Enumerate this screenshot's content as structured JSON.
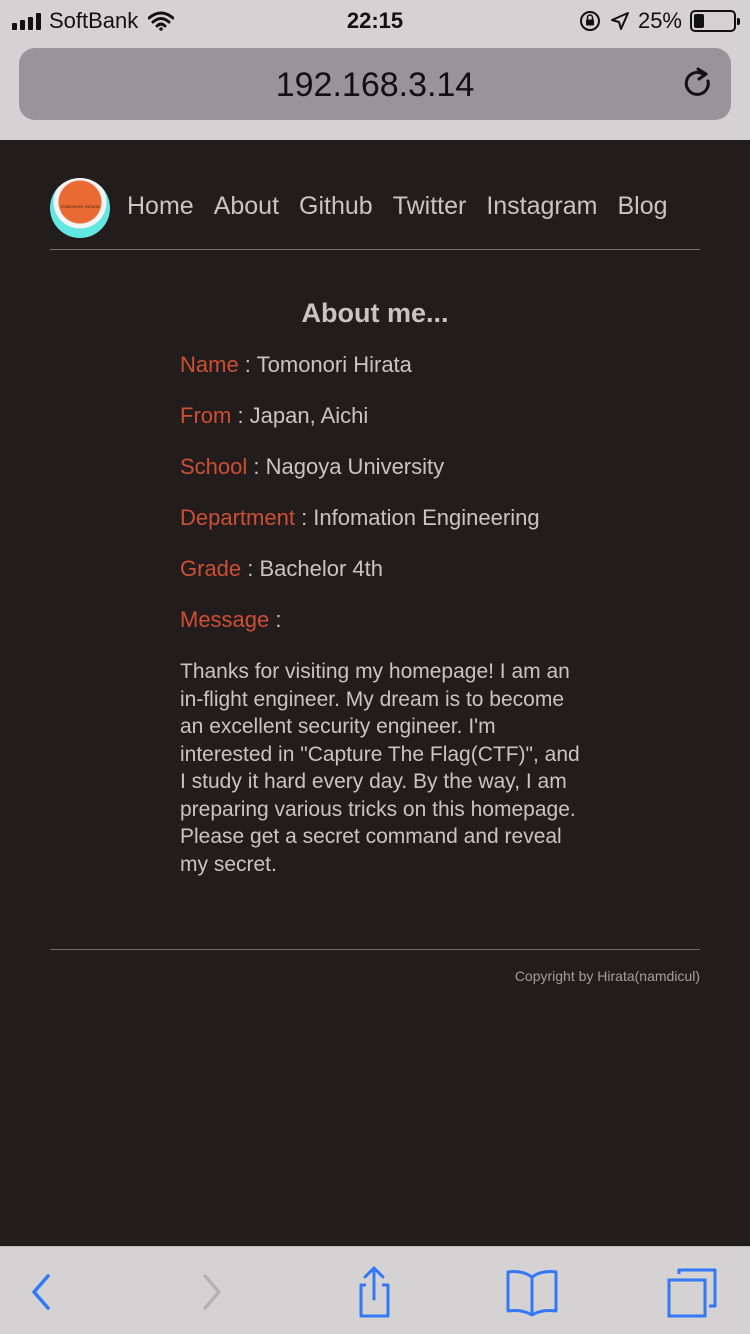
{
  "status_bar": {
    "carrier": "SoftBank",
    "time": "22:15",
    "battery": "25%",
    "battery_level": 0.25,
    "icons": [
      "signal-icon",
      "wifi-icon",
      "rotation-lock-icon",
      "location-icon",
      "battery-icon"
    ]
  },
  "browser": {
    "url": "192.168.3.14",
    "reload_icon": "reload-icon"
  },
  "site": {
    "logo_text": "TOMONORI HIRATA",
    "nav": [
      "Home",
      "About",
      "Github",
      "Twitter",
      "Instagram",
      "Blog"
    ]
  },
  "about": {
    "title": "About me...",
    "fields": [
      {
        "label": "Name",
        "value": " : Tomonori Hirata"
      },
      {
        "label": "From",
        "value": " : Japan, Aichi"
      },
      {
        "label": "School",
        "value": " : Nagoya University"
      },
      {
        "label": "Department",
        "value": " : Infomation Engineering"
      },
      {
        "label": "Grade",
        "value": " : Bachelor 4th"
      },
      {
        "label": "Message",
        "value": " :"
      }
    ],
    "message": "Thanks for visiting my homepage! I am an in-flight engineer. My dream is to become an excellent security engineer. I'm interested in \"Capture The Flag(CTF)\", and I study it hard every day. By the way, I am preparing various tricks on this homepage. Please get a secret command and reveal my secret."
  },
  "footer": {
    "copyright": "Copyright by Hirata(namdicul)"
  },
  "colors": {
    "background": "#231c1c",
    "text": "#c9c3c3",
    "label": "#cc4f34",
    "ios_blue": "#3478f6"
  },
  "toolbar": {
    "icons": [
      "back-icon",
      "forward-icon",
      "share-icon",
      "bookmarks-icon",
      "tabs-icon"
    ]
  }
}
